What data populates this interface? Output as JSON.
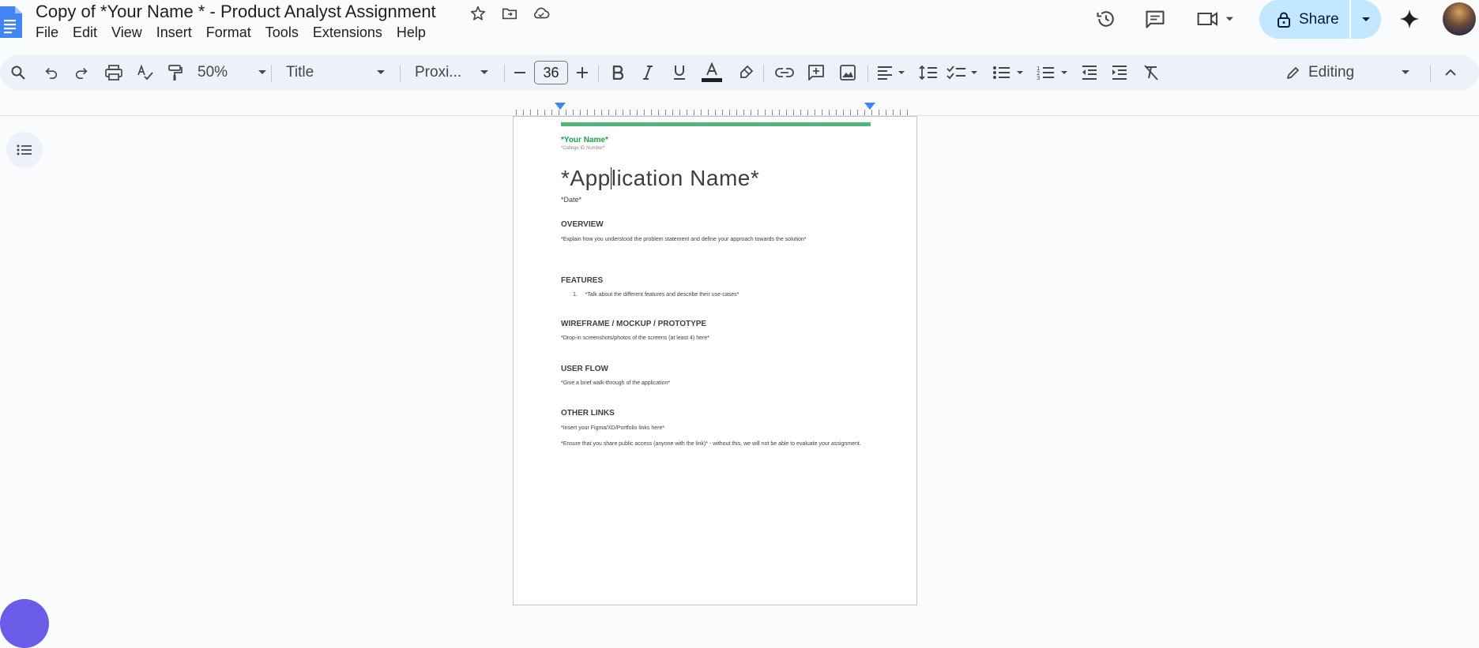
{
  "app": {
    "doc_title": "Copy of *Your Name * - Product Analyst Assignment",
    "menus": [
      "File",
      "Edit",
      "View",
      "Insert",
      "Format",
      "Tools",
      "Extensions",
      "Help"
    ],
    "share_label": "Share"
  },
  "toolbar": {
    "zoom": "50%",
    "style": "Title",
    "font": "Proxi...",
    "font_size": "36",
    "mode": "Editing"
  },
  "document": {
    "your_name": "*Your Name*",
    "college_id": "*College ID Number*",
    "app_name_before_caret": "*App",
    "app_name_after_caret": "lication Name*",
    "date": "*Date*",
    "sections": {
      "overview_heading": "OVERVIEW",
      "overview_body": "*Explain how you understood the problem statement and define your approach towards the solution*",
      "features_heading": "FEATURES",
      "features_item_number": "1.",
      "features_item": "*Talk about the different features and describe their use-cases*",
      "wireframe_heading": "WIREFRAME / MOCKUP / PROTOTYPE",
      "wireframe_body": "*Drop-in screenshots/photos of the screens (at least 4) here*",
      "userflow_heading": "USER FLOW",
      "userflow_body": "*Give a brief walk-through of the application*",
      "links_heading": "OTHER LINKS",
      "links_body": "*Insert your Figma/XD/Portfolio links here*",
      "links_note": "*Ensure that you share public access (anyone with the link)* - without this, we will not be able to evaluate your assignment."
    }
  },
  "colors": {
    "accent_green": "#1aa34a",
    "rule_green": "#4fb67c",
    "share_bg": "#c2e7ff",
    "toolbar_bg": "#edf2fa",
    "docs_blue": "#4285f4"
  }
}
